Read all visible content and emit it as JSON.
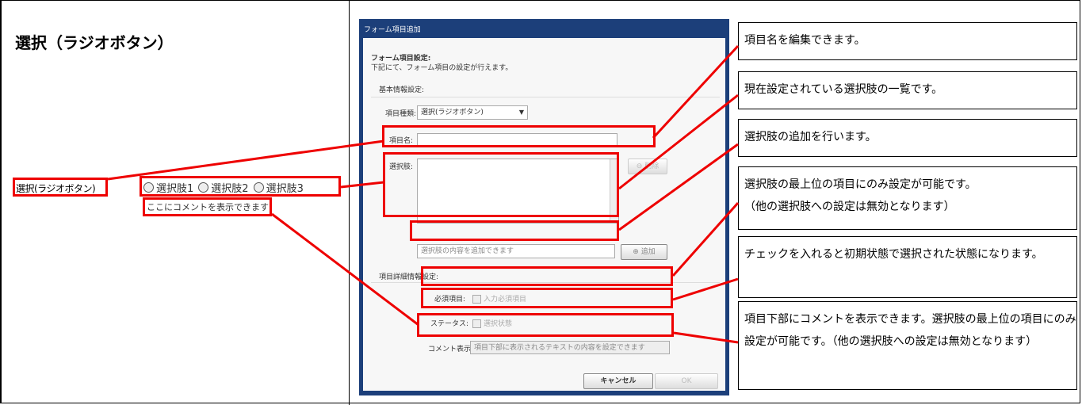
{
  "title": "選択（ラジオボタン）",
  "preview": {
    "label": "選択(ラジオボタン)",
    "options": [
      "選択肢1",
      "選択肢2",
      "選択肢3"
    ],
    "comment": "ここにコメントを表示できます"
  },
  "dialog": {
    "title": "フォーム項目追加",
    "section_title": "フォーム項目設定:",
    "section_desc": "下記にて、フォーム項目の設定が行えます。",
    "basic_heading": "基本情報設定:",
    "type_label": "項目種類:",
    "type_value": "選択(ラジオボタン)",
    "name_label": "項目名:",
    "choices_label": "選択肢:",
    "delete_label": "削除",
    "add_placeholder": "選択肢の内容を追加できます",
    "add_label": "追加",
    "detail_heading": "項目詳細情報設定:",
    "required_label": "必須項目:",
    "required_value": "入力必須項目",
    "status_label": "ステータス:",
    "status_value": "選択状態",
    "comment_label": "コメント表示:",
    "comment_placeholder": "項目下部に表示されるテキストの内容を設定できます",
    "cancel_label": "キャンセル",
    "ok_label": "OK"
  },
  "callouts": [
    "項目名を編集できます。",
    "現在設定されている選択肢の一覧です。",
    "選択肢の追加を行います。",
    "選択肢の最上位の項目にのみ設定が可能です。\n（他の選択肢への設定は無効となります）",
    "チェックを入れると初期状態で選択された状態になります。",
    "項目下部にコメントを表示できます。選択肢の最上位の項目にのみ設定が可能です。（他の選択肢への設定は無効となります）"
  ],
  "colors": {
    "highlight": "#e00000",
    "dialog_frame": "#1c3f7a"
  }
}
